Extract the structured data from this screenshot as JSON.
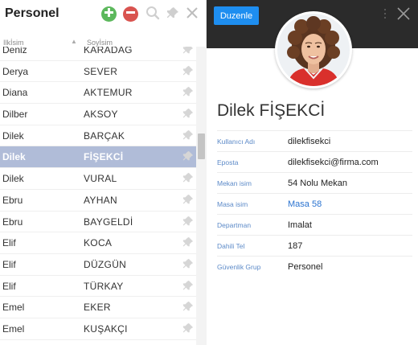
{
  "left_panel": {
    "title": "Personel",
    "col_first": "Ilkİsim",
    "col_last": "Soyİsim",
    "rows": [
      {
        "first": "Deniz",
        "last": "KARADAĞ"
      },
      {
        "first": "Derya",
        "last": "SEVER"
      },
      {
        "first": "Diana",
        "last": "AKTEMUR"
      },
      {
        "first": "Dilber",
        "last": "AKSOY"
      },
      {
        "first": "Dilek",
        "last": "BARÇAK"
      },
      {
        "first": "Dilek",
        "last": "FİŞEKCİ"
      },
      {
        "first": "Dilek",
        "last": "VURAL"
      },
      {
        "first": "Ebru",
        "last": "AYHAN"
      },
      {
        "first": "Ebru",
        "last": "BAYGELDİ"
      },
      {
        "first": "Elif",
        "last": "KOCA"
      },
      {
        "first": "Elif",
        "last": "DÜZGÜN"
      },
      {
        "first": "Elif",
        "last": "TÜRKAY"
      },
      {
        "first": "Emel",
        "last": "EKER"
      },
      {
        "first": "Emel",
        "last": "KUŞAKÇI"
      }
    ],
    "selected_index": 5
  },
  "right_panel": {
    "edit_label": "Duzenle",
    "name": "Dilek FİŞEKCİ",
    "fields": {
      "username": {
        "label": "Kullanıcı Adı",
        "value": "dilekfisekci"
      },
      "email": {
        "label": "Eposta",
        "value": "dilekfisekci@firma.com"
      },
      "location": {
        "label": "Mekan isim",
        "value": "54 Nolu Mekan"
      },
      "desk": {
        "label": "Masa isim",
        "value": "Masa 58"
      },
      "department": {
        "label": "Departman",
        "value": "Imalat"
      },
      "extension": {
        "label": "Dahili Tel",
        "value": "187"
      },
      "security_group": {
        "label": "Güvenlik Grup",
        "value": "Personel"
      }
    }
  },
  "colors": {
    "selected_row": "#b0bcd8",
    "add_button": "#5cb85c",
    "remove_button": "#d9534f",
    "edit_button": "#1e8ef0",
    "header_dark": "#2b2b2b",
    "label_blue": "#5c8ac8"
  },
  "icons": {
    "add": "plus-circle-icon",
    "remove": "minus-circle-icon",
    "search": "search-icon",
    "pin": "pin-icon",
    "close": "close-icon",
    "more": "more-vertical-icon"
  }
}
